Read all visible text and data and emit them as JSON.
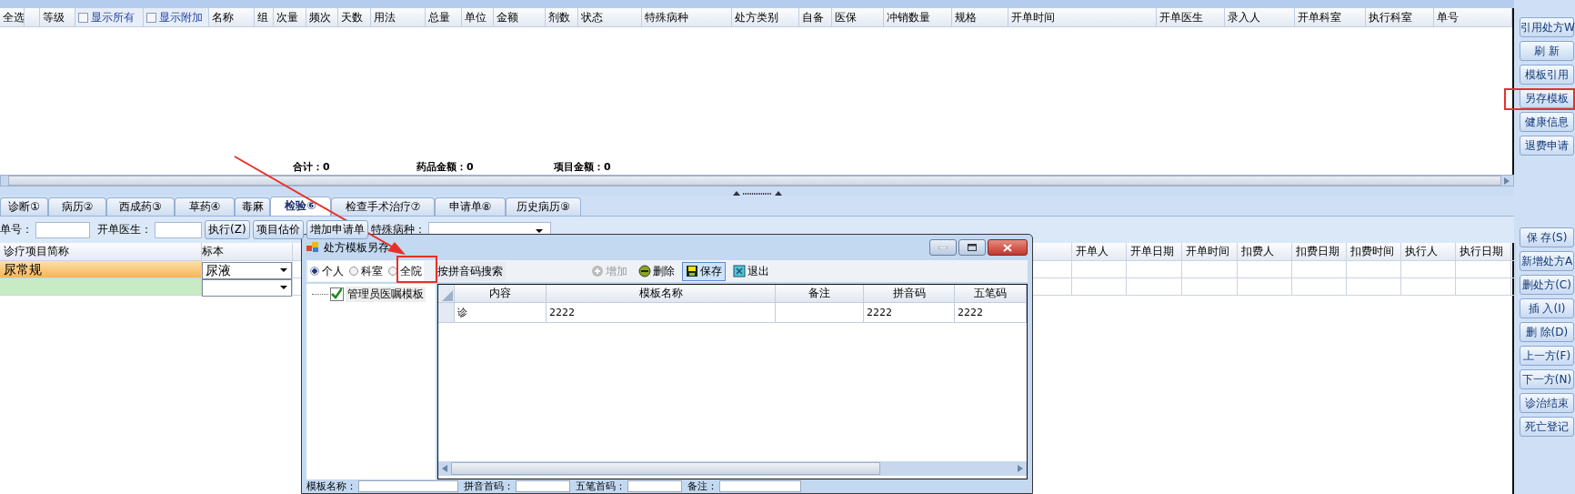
{
  "top_grid": {
    "columns": [
      {
        "kind": "text",
        "label": "全选"
      },
      {
        "kind": "blank"
      },
      {
        "kind": "text",
        "label": "等级"
      },
      {
        "kind": "checkbox",
        "label": "显示所有",
        "checked": false
      },
      {
        "kind": "checkbox",
        "label": "显示附加",
        "checked": false
      },
      {
        "kind": "text",
        "label": "名称"
      },
      {
        "kind": "text",
        "label": "组"
      },
      {
        "kind": "text",
        "label": "次量"
      },
      {
        "kind": "text",
        "label": "频次"
      },
      {
        "kind": "text",
        "label": "天数"
      },
      {
        "kind": "text",
        "label": "用法"
      },
      {
        "kind": "text",
        "label": "总量"
      },
      {
        "kind": "text",
        "label": "单位"
      },
      {
        "kind": "text",
        "label": "金额"
      },
      {
        "kind": "text",
        "label": "剂数"
      },
      {
        "kind": "text",
        "label": "状态"
      },
      {
        "kind": "text",
        "label": "特殊病种"
      },
      {
        "kind": "text",
        "label": "处方类别"
      },
      {
        "kind": "text",
        "label": "自备"
      },
      {
        "kind": "text",
        "label": "医保"
      },
      {
        "kind": "text",
        "label": "冲销数量"
      },
      {
        "kind": "text",
        "label": "规格"
      },
      {
        "kind": "text",
        "label": "开单时间"
      },
      {
        "kind": "text",
        "label": "开单医生"
      },
      {
        "kind": "text",
        "label": "录入人"
      },
      {
        "kind": "text",
        "label": "开单科室"
      },
      {
        "kind": "text",
        "label": "执行科室"
      },
      {
        "kind": "text",
        "label": "单号"
      }
    ],
    "totals": [
      {
        "label": "合计：",
        "value": "0"
      },
      {
        "label": "药品金额：",
        "value": "0"
      },
      {
        "label": "项目金额：",
        "value": "0"
      }
    ]
  },
  "tabs": [
    {
      "label": "诊断①",
      "selected": false
    },
    {
      "label": "病历②",
      "selected": false
    },
    {
      "label": "西成药③",
      "selected": false
    },
    {
      "label": "草药④",
      "selected": false
    },
    {
      "label": "毒麻",
      "selected": false
    },
    {
      "label": "检验⑥",
      "selected": true
    },
    {
      "label": "检查手术治疗⑦",
      "selected": false
    },
    {
      "label": "申请单⑧",
      "selected": false
    },
    {
      "label": "历史病历⑨",
      "selected": false
    }
  ],
  "toolbar": {
    "order_no_label": "单号：",
    "doctor_label": "开单医生：",
    "buttons": [
      "执行(Z)",
      "项目估价",
      "增加申请单"
    ],
    "disease_label": "特殊病种："
  },
  "lower_grid": {
    "left_columns": [
      "诊疗项目简称",
      "标本"
    ],
    "right_columns": [
      "开单人",
      "开单日期",
      "开单时间",
      "扣费人",
      "扣费日期",
      "扣费时间",
      "执行人",
      "执行日期"
    ],
    "rows": [
      {
        "kind": "item",
        "name": "尿常规",
        "specimen": "尿液",
        "selected": true
      },
      {
        "kind": "blank",
        "selected": false
      }
    ]
  },
  "dialog": {
    "title": "处方模板另存",
    "scopes": [
      {
        "label": "个人",
        "selected": true,
        "highlighted": false
      },
      {
        "label": "科室",
        "selected": false,
        "highlighted": false
      },
      {
        "label": "全院",
        "selected": false,
        "highlighted": true
      }
    ],
    "search_label": "按拼音码搜索",
    "actions": [
      {
        "kind": "add",
        "label": "增加",
        "disabled": true,
        "pressed": false
      },
      {
        "kind": "delete",
        "label": "删除",
        "disabled": false,
        "pressed": false
      },
      {
        "kind": "save",
        "label": "保存",
        "disabled": false,
        "pressed": true
      },
      {
        "kind": "exit",
        "label": "退出",
        "disabled": false,
        "pressed": false
      }
    ],
    "tree": [
      {
        "label": "管理员医嘱模板",
        "checked": true
      }
    ],
    "columns": [
      "内容",
      "模板名称",
      "备注",
      "拼音码",
      "五笔码"
    ],
    "rows": [
      {
        "content": "诊",
        "template_name": "2222",
        "pinyin": "2222",
        "wubi": "2222"
      }
    ],
    "form": [
      "模板名称：",
      "拼音首码：",
      "五笔首码：",
      "备注："
    ]
  },
  "sidebar": {
    "top_buttons": [
      {
        "label": "引用处方W",
        "highlighted": false
      },
      {
        "label": "刷 新",
        "highlighted": false
      },
      {
        "label": "模板引用",
        "highlighted": false
      },
      {
        "label": "另存模板",
        "highlighted": true
      },
      {
        "label": "健康信息",
        "highlighted": false
      },
      {
        "label": "退费申请",
        "highlighted": false
      }
    ],
    "bottom_buttons": [
      {
        "label": "保 存(S)"
      },
      {
        "label": "新增处方A"
      },
      {
        "label": "删处方(C)"
      },
      {
        "label": "插 入(I)"
      },
      {
        "label": "删 除(D)"
      },
      {
        "label": "上一方(F)"
      },
      {
        "label": "下一方(N)"
      },
      {
        "label": "诊治结束"
      },
      {
        "label": "死亡登记"
      }
    ]
  }
}
